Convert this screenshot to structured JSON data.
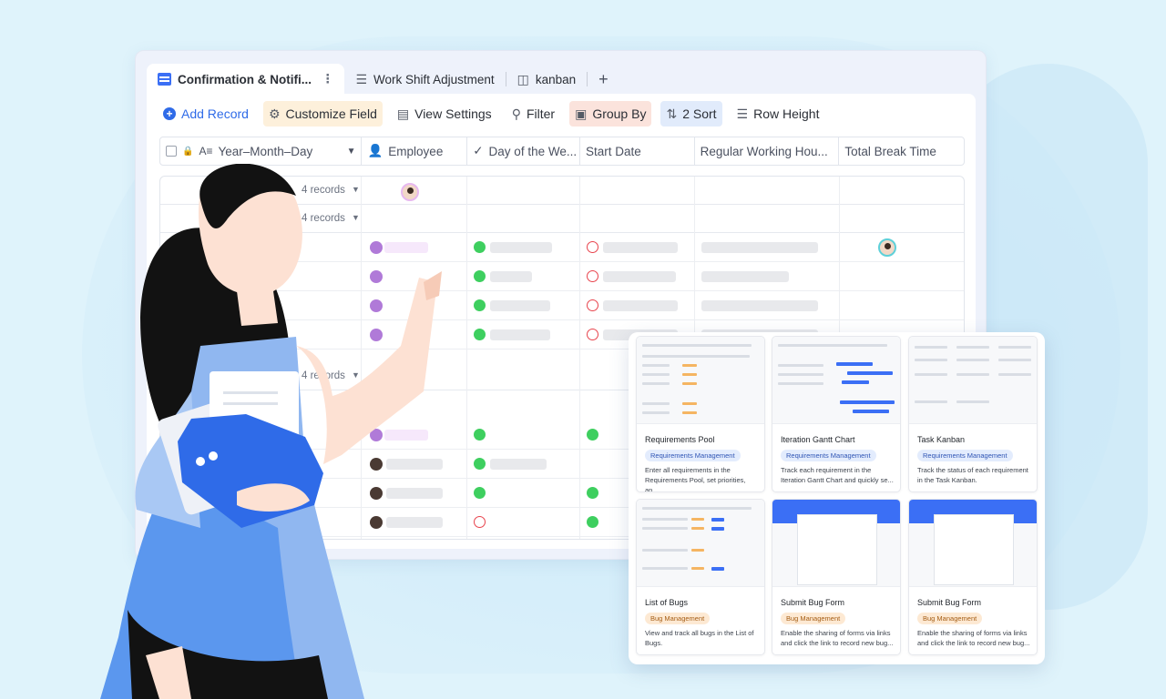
{
  "tabs": [
    {
      "label": "Confirmation & Notifi...",
      "icon": "grid-view-icon"
    },
    {
      "label": "Work Shift Adjustment",
      "icon": "gantt-icon"
    },
    {
      "label": "kanban",
      "icon": "kanban-icon"
    }
  ],
  "toolbar": {
    "add_record": "Add Record",
    "customize_field": "Customize Field",
    "view_settings": "View Settings",
    "filter": "Filter",
    "group_by": "Group By",
    "sort": "2 Sort",
    "row_height": "Row Height"
  },
  "columns": [
    "Year–Month–Day",
    "Employee",
    "Day of the We...",
    "Start Date",
    "Regular Working Hou...",
    "Total Break Time"
  ],
  "groups": [
    "4 records",
    "4 records",
    "4 records"
  ],
  "templates": [
    {
      "title": "Requirements Pool",
      "tag": "Requirements Management",
      "desc": "Enter all requirements in the Requirements Pool, set priorities, an..."
    },
    {
      "title": "Iteration Gantt Chart",
      "tag": "Requirements Management",
      "desc": "Track each requirement in the Iteration Gantt Chart and quickly se..."
    },
    {
      "title": "Task Kanban",
      "tag": "Requirements Management",
      "desc": "Track the status of each requirement in the Task Kanban."
    },
    {
      "title": "List of Bugs",
      "tag": "Bug Management",
      "desc": "View and track all bugs in the List of Bugs."
    },
    {
      "title": "Submit Bug Form",
      "tag": "Bug Management",
      "desc": "Enable the sharing of forms via links and click the link to record new bug..."
    },
    {
      "title": "Submit Bug Form",
      "tag": "Bug Management",
      "desc": "Enable the sharing of forms via links and click the link to record new bug..."
    }
  ],
  "colors": {
    "accent": "#3b6ff5",
    "background": "#dff3fb"
  }
}
